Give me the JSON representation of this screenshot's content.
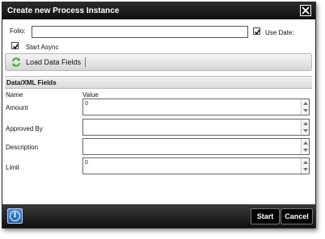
{
  "dialog": {
    "title": "Create new Process Instance",
    "close_icon": "close-x-icon"
  },
  "form": {
    "folio_label": "Folio:",
    "folio_value": "",
    "use_date_label": "Use Date:",
    "use_date_checked": true,
    "start_async_label": "Start Async",
    "start_async_checked": true
  },
  "toolbar": {
    "load_label": "Load Data Fields",
    "load_icon": "refresh-arrows-icon"
  },
  "section": {
    "title": "Data/XML Fields",
    "col_name": "Name",
    "col_value": "Value"
  },
  "fields": [
    {
      "name": "Amount",
      "value": "0"
    },
    {
      "name": "Approved By",
      "value": ""
    },
    {
      "name": "Description",
      "value": ""
    },
    {
      "name": "Limit",
      "value": "0"
    }
  ],
  "footer": {
    "info_icon": "info-icon",
    "start_label": "Start",
    "cancel_label": "Cancel"
  },
  "colors": {
    "titlebar": "#111111",
    "footer": "#1a1a1a",
    "info_button": "#2f74c8"
  }
}
